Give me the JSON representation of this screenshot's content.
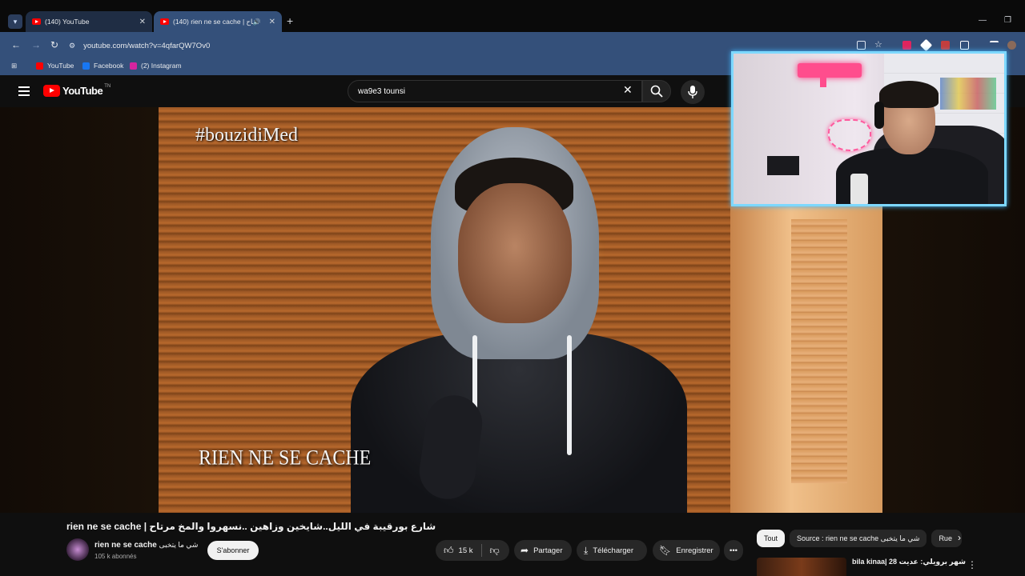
{
  "browser": {
    "tabs": [
      {
        "title": "(140) YouTube"
      },
      {
        "title": "(140) rien ne se cache | مرتاح"
      }
    ],
    "url": "youtube.com/watch?v=4qfarQW7Ov0",
    "bookmarks": [
      {
        "label": "YouTube"
      },
      {
        "label": "Facebook"
      },
      {
        "label": "(2) Instagram"
      }
    ]
  },
  "youtube": {
    "logo_text": "YouTube",
    "logo_suffix": "TN",
    "search_value": "wa9e3 tounsi"
  },
  "video": {
    "watermark_top": "#bouzidiMed",
    "watermark_bottom": "RIEN NE SE CACHE"
  },
  "details": {
    "title": "rien ne se cache | شارع بورقيبة في الليل..شايخين وزاهين ..نسهروا والمخ مرتاح",
    "channel_name": "rien ne se cache",
    "channel_name_ar": "شي ما يتخبى",
    "subscribers": "105 k abonnés",
    "subscribe_label": "S'abonner",
    "likes": "15 k",
    "share_label": "Partager",
    "download_label": "Télécharger",
    "save_label": "Enregistrer"
  },
  "sidebar": {
    "chips": [
      "Tout",
      "Source : rien ne se cache شي ما يتخبى",
      "Rue"
    ],
    "rec_title": "bila kinaa| 28 شهر برويلي: عديت"
  },
  "colors": {
    "brand_red": "#ff0000",
    "webcam_border": "#7dd8ff",
    "chrome_blue": "#34507a"
  }
}
